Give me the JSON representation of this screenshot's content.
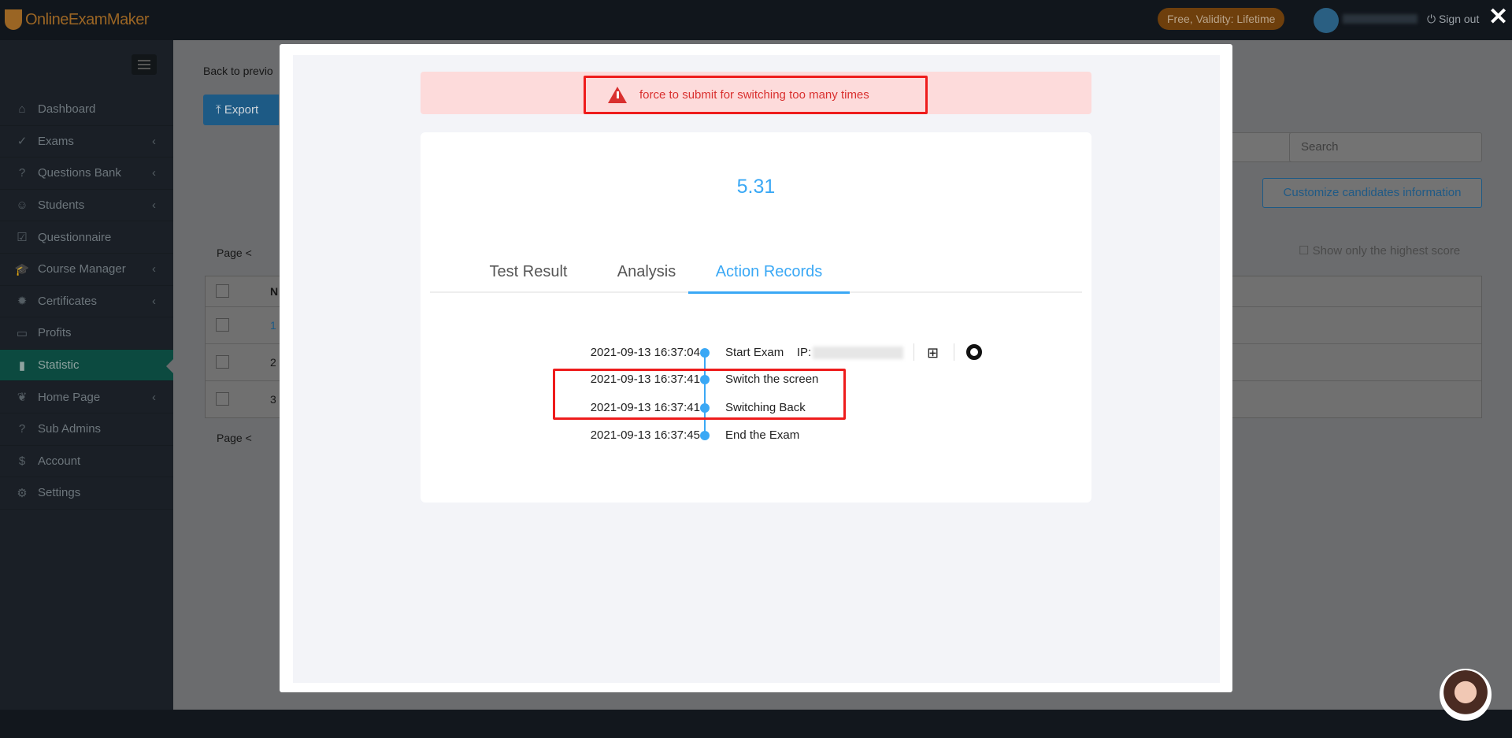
{
  "topbar": {
    "logo": "OnlineExamMaker",
    "plan_badge": "Free, Validity: Lifetime",
    "signout": "Sign out"
  },
  "sidebar": {
    "items": [
      {
        "label": "Dashboard",
        "icon": "home-icon",
        "chevron": false
      },
      {
        "label": "Exams",
        "icon": "check-circle-icon",
        "chevron": true
      },
      {
        "label": "Questions Bank",
        "icon": "question-circle-icon",
        "chevron": true
      },
      {
        "label": "Students",
        "icon": "users-icon",
        "chevron": true
      },
      {
        "label": "Questionnaire",
        "icon": "checkbox-icon",
        "chevron": false
      },
      {
        "label": "Course Manager",
        "icon": "graduation-cap-icon",
        "chevron": true
      },
      {
        "label": "Certificates",
        "icon": "certificate-icon",
        "chevron": true
      },
      {
        "label": "Profits",
        "icon": "credit-card-icon",
        "chevron": false
      },
      {
        "label": "Statistic",
        "icon": "bar-chart-icon",
        "chevron": false,
        "active": true
      },
      {
        "label": "Home Page",
        "icon": "leaf-icon",
        "chevron": true
      },
      {
        "label": "Sub Admins",
        "icon": "question-circle-icon",
        "chevron": false
      },
      {
        "label": "Account",
        "icon": "dollar-icon",
        "chevron": false
      },
      {
        "label": "Settings",
        "icon": "gear-icon",
        "chevron": false
      }
    ]
  },
  "main": {
    "back_link": "Back to previo",
    "export": "Export",
    "search_placeholder": "Search",
    "customize": "Customize candidates information",
    "highest_only": "Show only the highest score",
    "page_label": "Page",
    "table_header_col2": "N",
    "rows": [
      "1",
      "2",
      "3"
    ]
  },
  "modal": {
    "alert": "force to submit for switching too many times",
    "score": "5.31",
    "tabs": [
      {
        "label": "Test Result"
      },
      {
        "label": "Analysis"
      },
      {
        "label": "Action Records",
        "active": true
      }
    ],
    "ip_label": "IP:",
    "records": [
      {
        "time": "2021-09-13 16:37:04",
        "action": "Start Exam"
      },
      {
        "time": "2021-09-13 16:37:41",
        "action": "Switch the screen"
      },
      {
        "time": "2021-09-13 16:37:41",
        "action": "Switching Back"
      },
      {
        "time": "2021-09-13 16:37:45",
        "action": "End the Exam"
      }
    ]
  },
  "colors": {
    "accent": "#3aa8f5",
    "alert_bg": "#fddbdb",
    "alert_text": "#d9302f",
    "highlight": "#ee1c1c",
    "sidebar_active": "#0f9e86"
  }
}
